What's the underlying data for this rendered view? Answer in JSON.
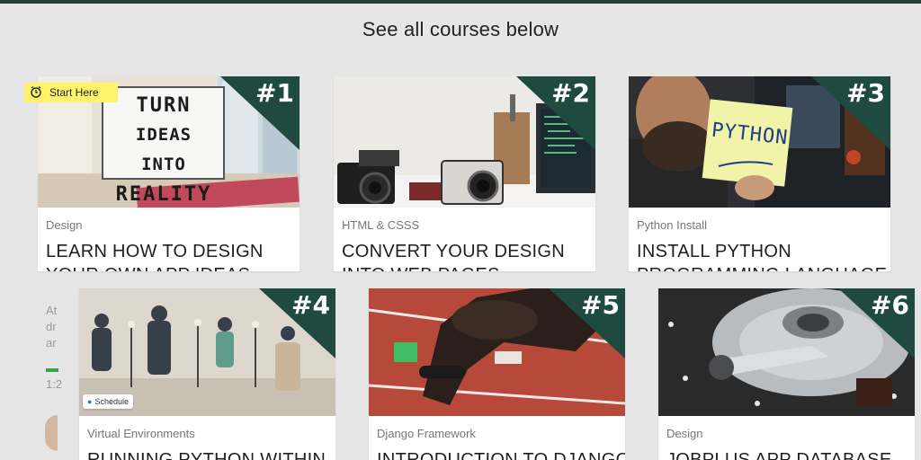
{
  "page": {
    "heading": "See all courses below"
  },
  "start_badge": {
    "label": "Start Here"
  },
  "courses": [
    {
      "rank": "#1",
      "category": "Design",
      "title": "LEARN HOW TO DESIGN",
      "title_line2": "YOUR OWN APP IDEAS",
      "image_text": [
        "TURN",
        "IDEAS INTO",
        "REALITY"
      ]
    },
    {
      "rank": "#2",
      "category": "HTML & CSSS",
      "title": "CONVERT YOUR DESIGN",
      "title_line2": "INTO WEB PAGES"
    },
    {
      "rank": "#3",
      "category": "Python Install",
      "title": "INSTALL PYTHON",
      "title_line2": "PROGRAMMING LANGUAGE",
      "image_text": [
        "PYTHON"
      ]
    },
    {
      "rank": "#4",
      "category": "Virtual Environments",
      "title": "RUNNING PYTHON WITHIN",
      "chip": "Schedule"
    },
    {
      "rank": "#5",
      "category": "Django Framework",
      "title": "INTRODUCTION TO DJANGO"
    },
    {
      "rank": "#6",
      "category": "Design",
      "title": "JOBPLUS APP DATABASE"
    }
  ],
  "background_card": {
    "text_lines": [
      "At",
      "dr",
      "ar"
    ],
    "time": "1:2"
  },
  "colors": {
    "rank_bg": "#1f4a40",
    "badge_bg": "#fff36b",
    "page_bg": "#e6e6e6",
    "progress": "#3aa34a"
  }
}
